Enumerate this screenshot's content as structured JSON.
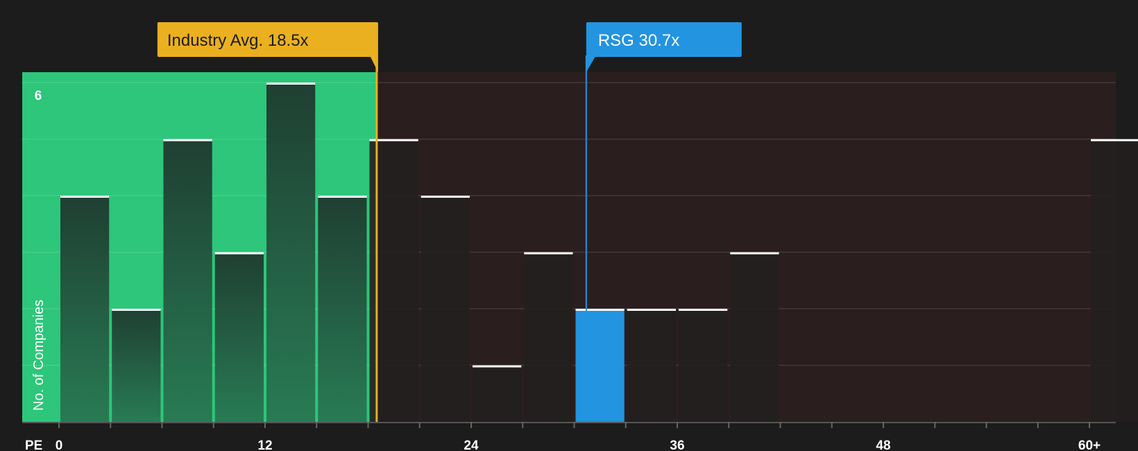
{
  "chart_data": {
    "type": "bar",
    "xlabel": "PE",
    "ylabel": "No. of Companies",
    "x_ticks": [
      "0",
      "12",
      "24",
      "36",
      "48",
      "60+"
    ],
    "y_ticks": [
      "6"
    ],
    "ylim": [
      0,
      6.2
    ],
    "bin_width": 3,
    "bins": [
      {
        "from": 0,
        "to": 3,
        "count": 4
      },
      {
        "from": 3,
        "to": 6,
        "count": 2
      },
      {
        "from": 6,
        "to": 9,
        "count": 5
      },
      {
        "from": 9,
        "to": 12,
        "count": 3
      },
      {
        "from": 12,
        "to": 15,
        "count": 6
      },
      {
        "from": 15,
        "to": 18,
        "count": 4
      },
      {
        "from": 18,
        "to": 21,
        "count": 5
      },
      {
        "from": 21,
        "to": 24,
        "count": 4
      },
      {
        "from": 24,
        "to": 27,
        "count": 1
      },
      {
        "from": 27,
        "to": 30,
        "count": 3
      },
      {
        "from": 30,
        "to": 33,
        "count": 2,
        "highlight": true
      },
      {
        "from": 33,
        "to": 36,
        "count": 2
      },
      {
        "from": 36,
        "to": 39,
        "count": 2
      },
      {
        "from": 39,
        "to": 42,
        "count": 3
      },
      {
        "from": 60,
        "to": 63,
        "count": 5
      }
    ],
    "markers": [
      {
        "name": "industry-avg",
        "label": "Industry Avg. 18.5x",
        "value": 18.5,
        "color": "#eab01f"
      },
      {
        "name": "rsg",
        "label": "RSG 30.7x",
        "value": 30.7,
        "color": "#2394e0"
      }
    ],
    "regions": [
      {
        "name": "below-average",
        "from": 0,
        "to": 18.5,
        "color": "#2dc67a"
      },
      {
        "name": "above-average",
        "from": 18.5,
        "to": 63,
        "color": "#2e1f20"
      }
    ],
    "grid": true
  }
}
